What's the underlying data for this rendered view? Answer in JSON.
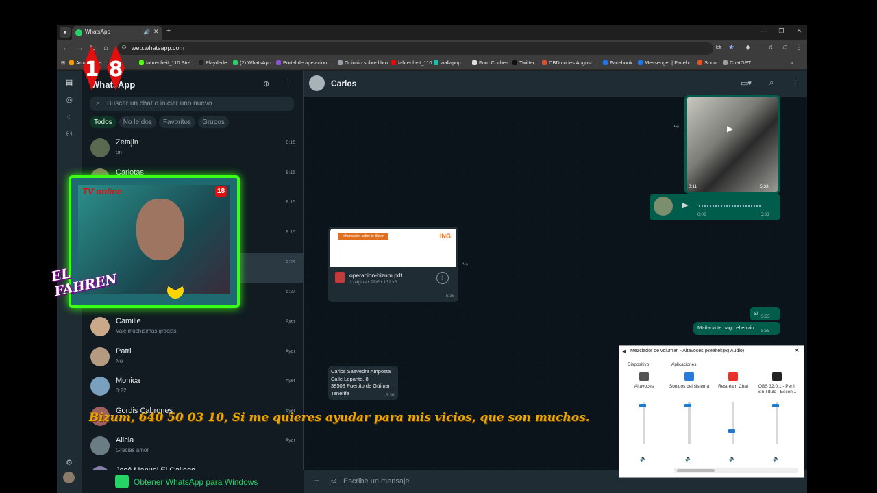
{
  "browser": {
    "tab_title": "WhatsApp",
    "url": "web.whatsapp.com",
    "bookmarks": [
      {
        "label": "Amazon.es...",
        "color": "#ff9900"
      },
      {
        "label": "fahrenheit_110 Stre...",
        "color": "#53fc18"
      },
      {
        "label": "Playdede",
        "color": "#222222"
      },
      {
        "label": "(2) WhatsApp",
        "color": "#25d366"
      },
      {
        "label": "Portal de apelacion...",
        "color": "#8a4fd8"
      },
      {
        "label": "Opinión sobre libro",
        "color": "#9aa0a6"
      },
      {
        "label": "fahrenheit_110",
        "color": "#ff0000"
      },
      {
        "label": "wallapop",
        "color": "#13c1ac"
      },
      {
        "label": "Foro Coches",
        "color": "#dddddd"
      },
      {
        "label": "Twitter",
        "color": "#111111"
      },
      {
        "label": "DBD codes August...",
        "color": "#e0502e"
      },
      {
        "label": "Facebook",
        "color": "#1877f2"
      },
      {
        "label": "Messenger | Facebo...",
        "color": "#1877f2"
      },
      {
        "label": "Suno",
        "color": "#f05020"
      },
      {
        "label": "ChatGPT",
        "color": "#9aa0a6"
      }
    ]
  },
  "sidebar": {
    "title": "WhatsApp",
    "search_placeholder": "Buscar un chat o iniciar uno nuevo",
    "filters": [
      "Todos",
      "No leídos",
      "Favoritos",
      "Grupos"
    ],
    "chats": [
      {
        "name": "Zetajin",
        "preview": "on",
        "time": "8:16"
      },
      {
        "name": "Carlotas",
        "preview": "",
        "time": "8:15"
      },
      {
        "name": "",
        "preview": "",
        "time": "8:15"
      },
      {
        "name": "",
        "preview": "",
        "time": "8:15"
      },
      {
        "name": "",
        "preview": "",
        "time": "5:44"
      },
      {
        "name": "",
        "preview": "",
        "time": "5:27"
      },
      {
        "name": "Camille",
        "preview": "Vale muchísimas gracias",
        "time": "Ayer"
      },
      {
        "name": "Patri",
        "preview": "No",
        "time": "Ayer"
      },
      {
        "name": "Monica",
        "preview": "0:22",
        "time": "Ayer"
      },
      {
        "name": "Gordis Cabrones",
        "preview": "",
        "time": "Ayer"
      },
      {
        "name": "Alicia",
        "preview": "Gracias amor",
        "time": "Ayer"
      },
      {
        "name": "José Manuel El Gallego",
        "preview": "",
        "time": ""
      }
    ],
    "get_app": "Obtener WhatsApp para Windows"
  },
  "conversation": {
    "contact": "Carlos",
    "video_duration": "0:11",
    "video_time": "5:33",
    "voice_duration": "0:02",
    "voice_time": "5:33",
    "pdf_header": "Información sobre tu Bizum",
    "pdf_brand": "ING",
    "pdf_name": "operacion-bizum.pdf",
    "pdf_meta": "1 página • PDF • 132 kB",
    "pdf_time": "5:35",
    "msg_si": "Si",
    "msg_si_time": "5:35",
    "msg_manana": "Mañana te hago el envío",
    "msg_manana_time": "5:35",
    "address_lines": [
      "Carlos Saavedra Amposta",
      "Calle Lepanto, 8",
      "38508 Puertito de Güímar",
      "Tenerife"
    ],
    "address_time": "5:36",
    "composer_placeholder": "Escribe un mensaje"
  },
  "overlay": {
    "badge_left": "1",
    "badge_right": "8",
    "cam_label": "TV online",
    "cam_badge": "18",
    "logo": "EL FAHREN",
    "ticker": "Bizum, 640 50 03 10, Si me quieres ayudar para mis vicios, que son muchos."
  },
  "mixer": {
    "title": "Mezclador de volumen - Altavoces (Realtek(R) Audio)",
    "device_label": "Dispositivo",
    "apps_label": "Aplicaciones",
    "columns": [
      {
        "label": "Altavoces",
        "level": 0.95,
        "color": "#555555"
      },
      {
        "label": "Sonidos del sistema",
        "level": 0.95,
        "color": "#2a7ad8"
      },
      {
        "label": "Restream Chat",
        "level": 0.35,
        "color": "#e8322c"
      },
      {
        "label": "OBS 32.0.1 - Perfil Sin Título - Escen...",
        "level": 0.95,
        "color": "#222222"
      }
    ]
  }
}
